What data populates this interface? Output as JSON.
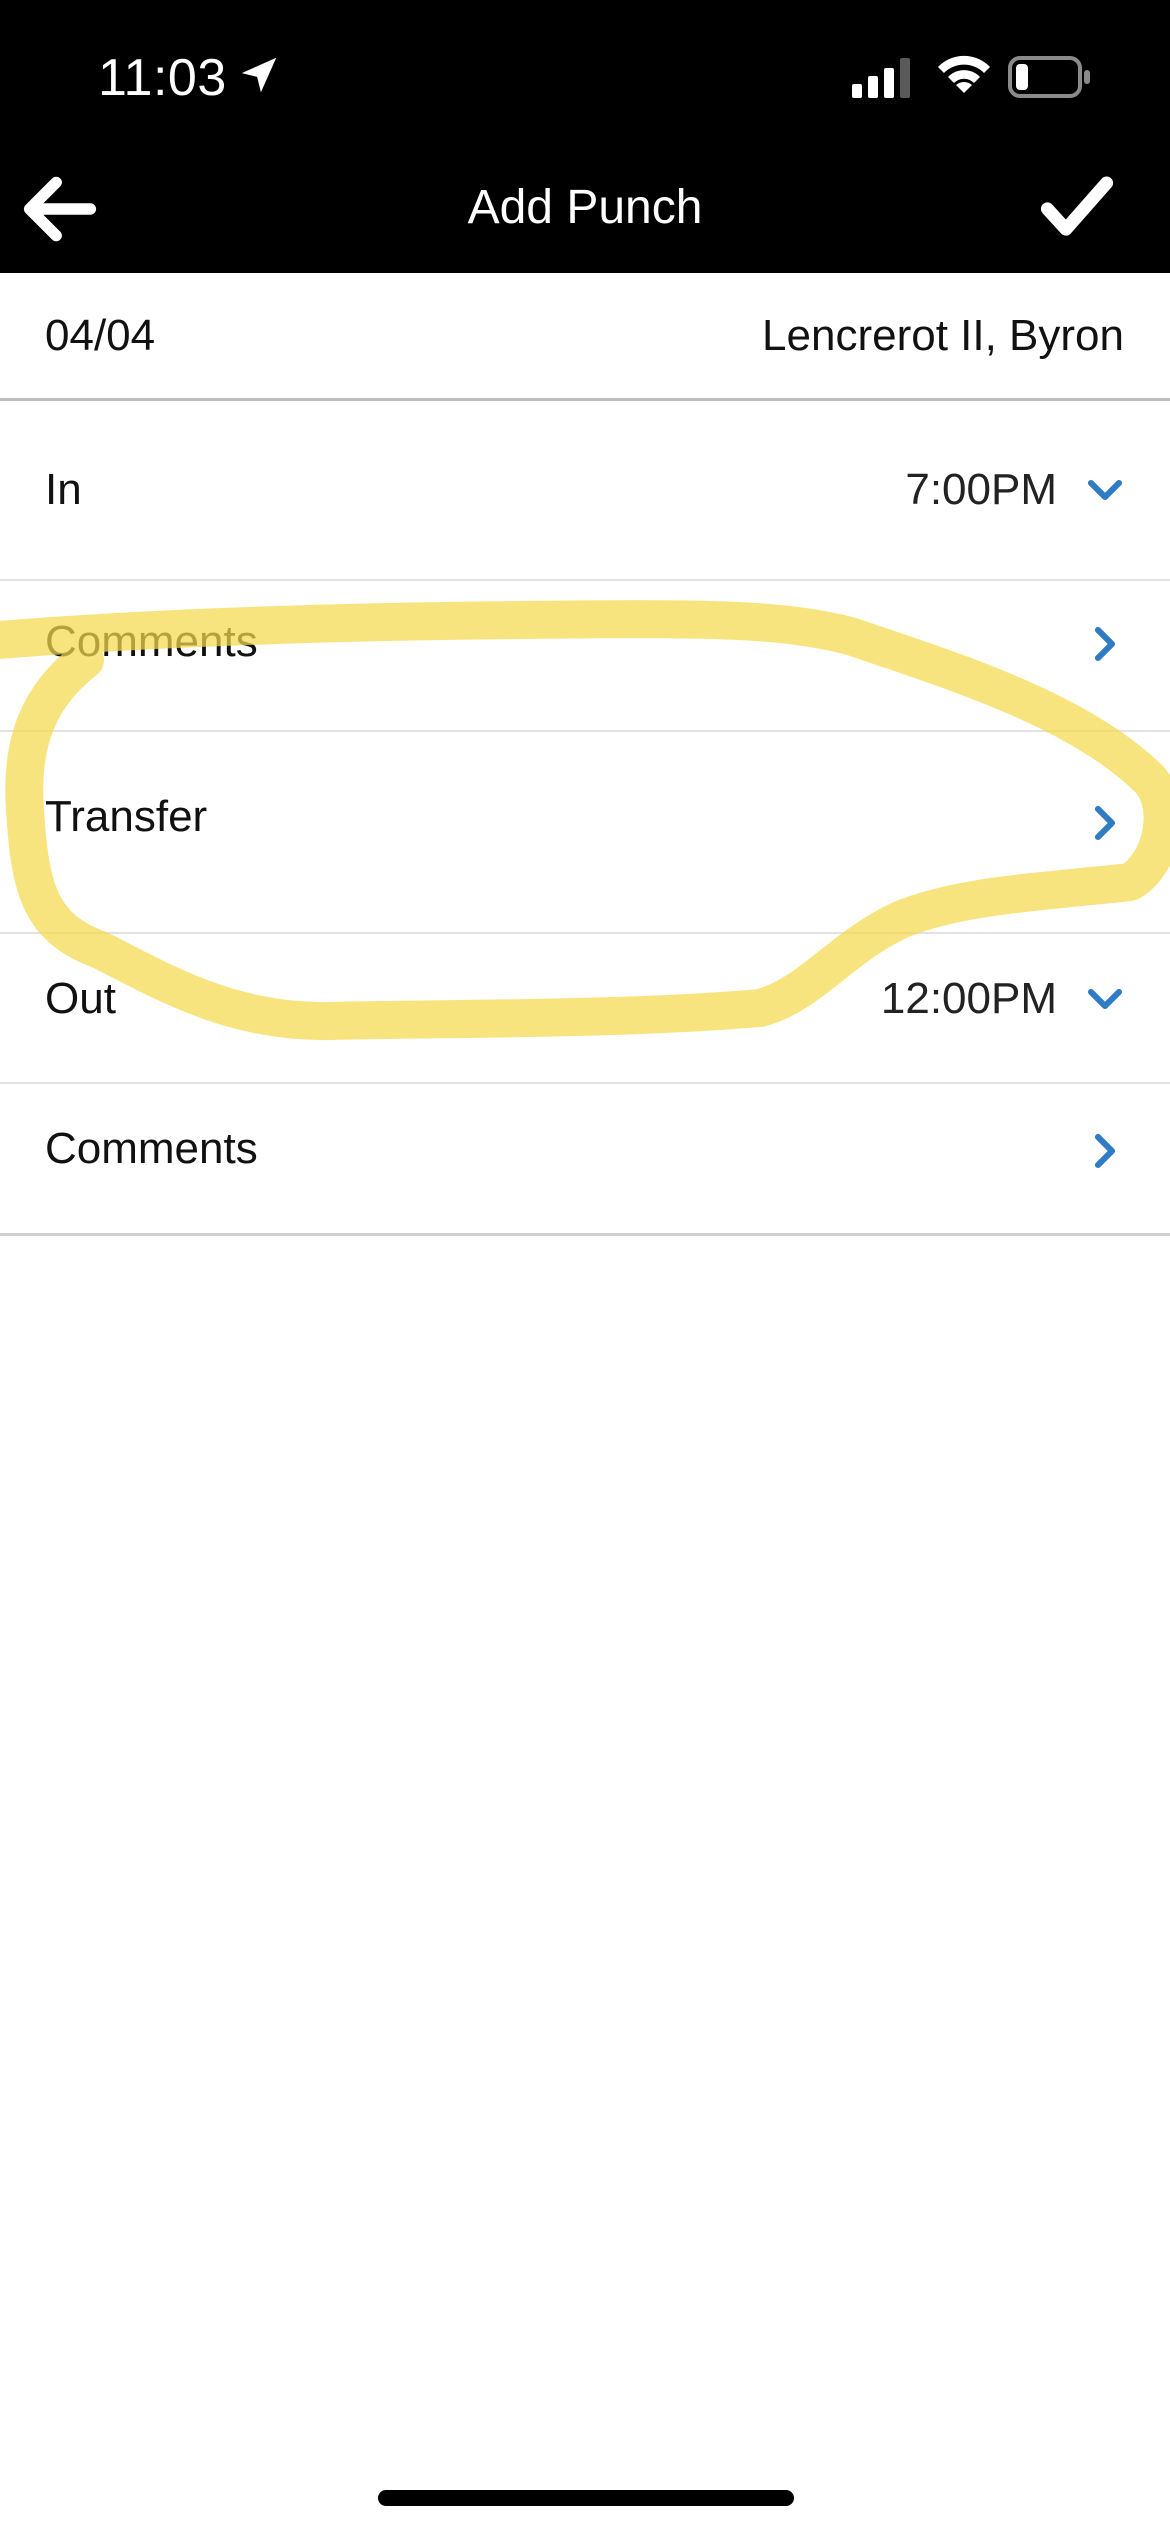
{
  "status_bar": {
    "time": "11:03",
    "icons": [
      "location-arrow-icon",
      "cellular-signal-icon",
      "wifi-icon",
      "battery-icon"
    ],
    "battery_level": 0.15
  },
  "nav": {
    "title": "Add Punch",
    "back_icon": "arrow-left-icon",
    "confirm_icon": "checkmark-icon"
  },
  "info": {
    "date": "04/04",
    "employee_name": "Lencrerot II, Byron"
  },
  "rows": [
    {
      "label": "In",
      "value": "7:00PM",
      "icon": "chevron-down-icon"
    },
    {
      "label": "Comments",
      "value": "",
      "icon": "chevron-right-icon"
    },
    {
      "label": "Transfer",
      "value": "",
      "icon": "chevron-right-icon"
    },
    {
      "label": "Out",
      "value": "12:00PM",
      "icon": "chevron-down-icon"
    },
    {
      "label": "Comments",
      "value": "",
      "icon": "chevron-right-icon"
    }
  ],
  "colors": {
    "bar_background": "#000000",
    "accent": "#2f7bc4",
    "highlighter": "#f5d94e"
  }
}
